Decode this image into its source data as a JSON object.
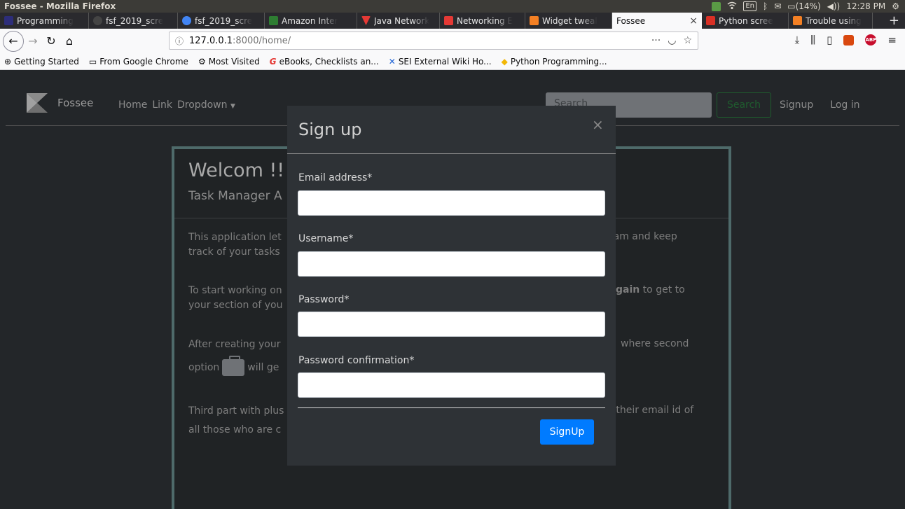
{
  "window": {
    "title": "Fossee - Mozilla Firefox"
  },
  "system_tray": {
    "language": "En",
    "battery": "(14%)",
    "time": "12:28 PM"
  },
  "tabs": [
    {
      "label": "Programming",
      "favicon_color": "#2d2d7a"
    },
    {
      "label": "fsf_2019_scre",
      "favicon_color": "#444444"
    },
    {
      "label": "fsf_2019_scre",
      "favicon_color": "#4285f4"
    },
    {
      "label": "Amazon Inter",
      "favicon_color": "#2e7d32"
    },
    {
      "label": "Java Network",
      "favicon_color": "#e53935"
    },
    {
      "label": "Networking E",
      "favicon_color": "#e53935"
    },
    {
      "label": "Widget tweal",
      "favicon_color": "#f48024"
    },
    {
      "label": "Fossee",
      "active": true
    },
    {
      "label": "Python scree",
      "favicon_color": "#d93025"
    },
    {
      "label": "Trouble using",
      "favicon_color": "#f48024"
    }
  ],
  "address_bar": {
    "host": "127.0.0.1",
    "rest": ":8000/home/"
  },
  "bookmarks": [
    {
      "label": "Getting Started",
      "icon": "globe-icon"
    },
    {
      "label": "From Google Chrome",
      "icon": "folder-icon"
    },
    {
      "label": "Most Visited",
      "icon": "gear-icon"
    },
    {
      "label": "eBooks, Checklists an...",
      "icon": "g-icon"
    },
    {
      "label": "SEI External Wiki Ho...",
      "icon": "confluence-icon"
    },
    {
      "label": "Python Programming...",
      "icon": "python-icon"
    }
  ],
  "site": {
    "brand": "Fossee",
    "nav": {
      "home": "Home",
      "link": "Link",
      "dropdown": "Dropdown"
    },
    "search_placeholder": "Search",
    "search_button": "Search",
    "signup": "Signup",
    "login": "Log in"
  },
  "card": {
    "title": "Welcom !!!",
    "subtitle": "Task Manager A",
    "p1_left_a": "This application let",
    "p1_left_b": "track of your tasks",
    "p1_right": "eam and keep",
    "p2_left_a": "To start working on",
    "p2_left_b": "your section of you",
    "p2_right_bold": "gain",
    "p2_right": " to get to",
    "p3_left_a": "After creating your",
    "p3_left_b_pre": "option",
    "p3_left_b_post": "will ge",
    "p3_right": "where second",
    "p4_left_a": "Third part with plus",
    "p4_left_b": "all those who are c",
    "p4_right": "g their email id of"
  },
  "modal": {
    "title": "Sign up",
    "fields": {
      "email_label": "Email address*",
      "username_label": "Username*",
      "password_label": "Password*",
      "password_confirm_label": "Password confirmation*"
    },
    "submit": "SignUp"
  }
}
